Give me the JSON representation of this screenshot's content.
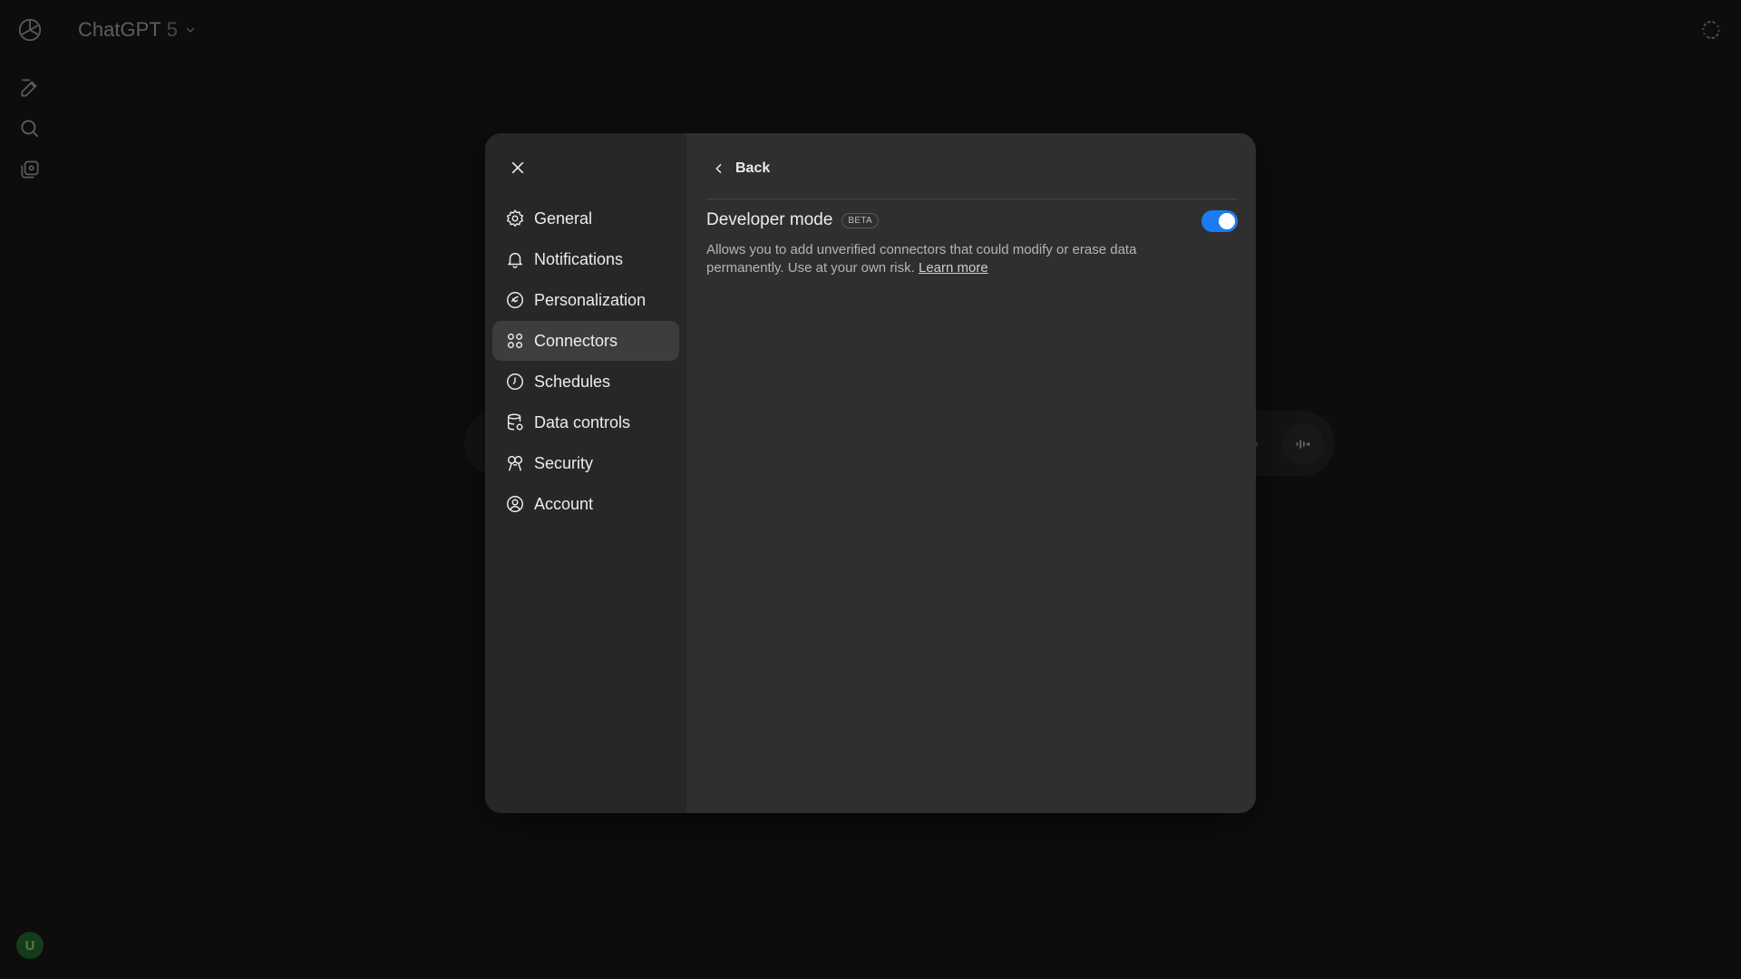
{
  "app": {
    "model_name": "ChatGPT",
    "model_version": "5",
    "avatar_initial": "U"
  },
  "modal": {
    "nav": [
      {
        "label": "General",
        "icon": "gear-icon",
        "active": false
      },
      {
        "label": "Notifications",
        "icon": "bell-icon",
        "active": false
      },
      {
        "label": "Personalization",
        "icon": "personalization-icon",
        "active": false
      },
      {
        "label": "Connectors",
        "icon": "connectors-icon",
        "active": true
      },
      {
        "label": "Schedules",
        "icon": "clock-icon",
        "active": false
      },
      {
        "label": "Data controls",
        "icon": "database-icon",
        "active": false
      },
      {
        "label": "Security",
        "icon": "security-icon",
        "active": false
      },
      {
        "label": "Account",
        "icon": "account-icon",
        "active": false
      }
    ],
    "back_label": "Back",
    "setting": {
      "title": "Developer mode",
      "badge": "BETA",
      "description": "Allows you to add unverified connectors that could modify or erase data permanently. Use at your own risk.",
      "link_label": "Learn more",
      "enabled": true
    }
  },
  "colors": {
    "toggle_on": "#1c7bf0",
    "modal_bg": "#2f2f2f",
    "sidebar_bg": "#272727",
    "active_item_bg": "#3d3d3d",
    "avatar_bg": "#1f6b2d"
  }
}
